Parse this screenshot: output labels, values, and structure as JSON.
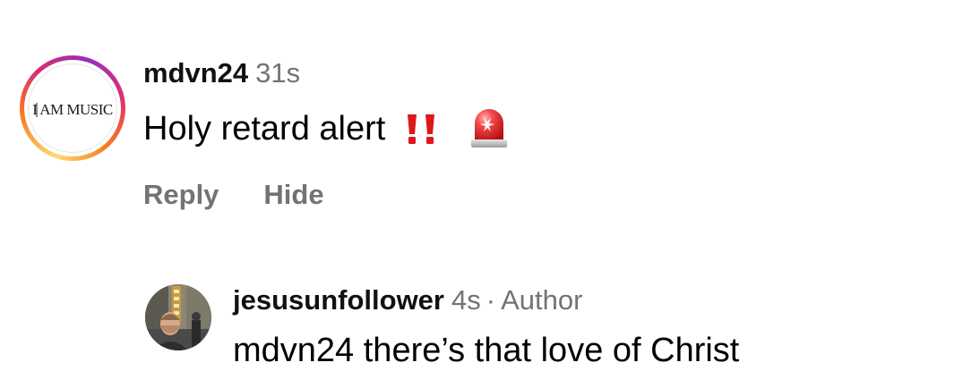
{
  "comment": {
    "username": "mdvn24",
    "time": "31s",
    "text": "Holy retard alert",
    "avatar_logo_text": "I AM MUSIC",
    "emojis": [
      "double-exclamation-icon",
      "police-siren-icon"
    ],
    "actions": {
      "reply_label": "Reply",
      "hide_label": "Hide"
    }
  },
  "reply": {
    "username": "jesusunfollower",
    "time": "4s",
    "separator": "·",
    "role": "Author",
    "text": "mdvn24 there’s that love of Christ"
  },
  "colors": {
    "secondary_text": "#737373",
    "primary_text": "#000000",
    "story_ring": [
      "#feda75",
      "#fa7e1e",
      "#d62976",
      "#962fbf"
    ],
    "emoji_red": "#e0161b"
  }
}
